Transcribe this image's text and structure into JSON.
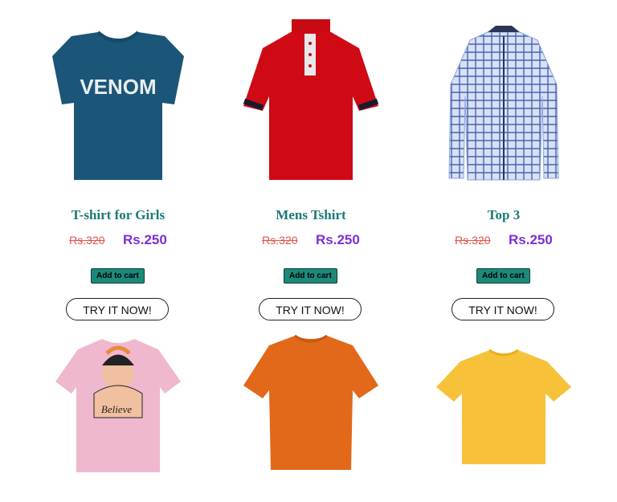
{
  "products": [
    {
      "title": "T-shirt for Girls",
      "old_price": "Rs.320",
      "price": "Rs.250",
      "cart_label": "Add to cart",
      "try_label": "TRY IT NOW!",
      "shirt_text": "VENOM",
      "color": "#1b5577"
    },
    {
      "title": "Mens Tshirt",
      "old_price": "Rs.320",
      "price": "Rs.250",
      "cart_label": "Add to cart",
      "try_label": "TRY IT NOW!",
      "color": "#cf0a14"
    },
    {
      "title": "Top 3",
      "old_price": "Rs.320",
      "price": "Rs.250",
      "cart_label": "Add to cart",
      "try_label": "TRY IT NOW!",
      "color": "#b9c9ea"
    }
  ],
  "bottom_products": [
    {
      "color": "#efb8cf",
      "print_text": "Believe"
    },
    {
      "color": "#e2681a"
    },
    {
      "color": "#f7c23a"
    }
  ]
}
